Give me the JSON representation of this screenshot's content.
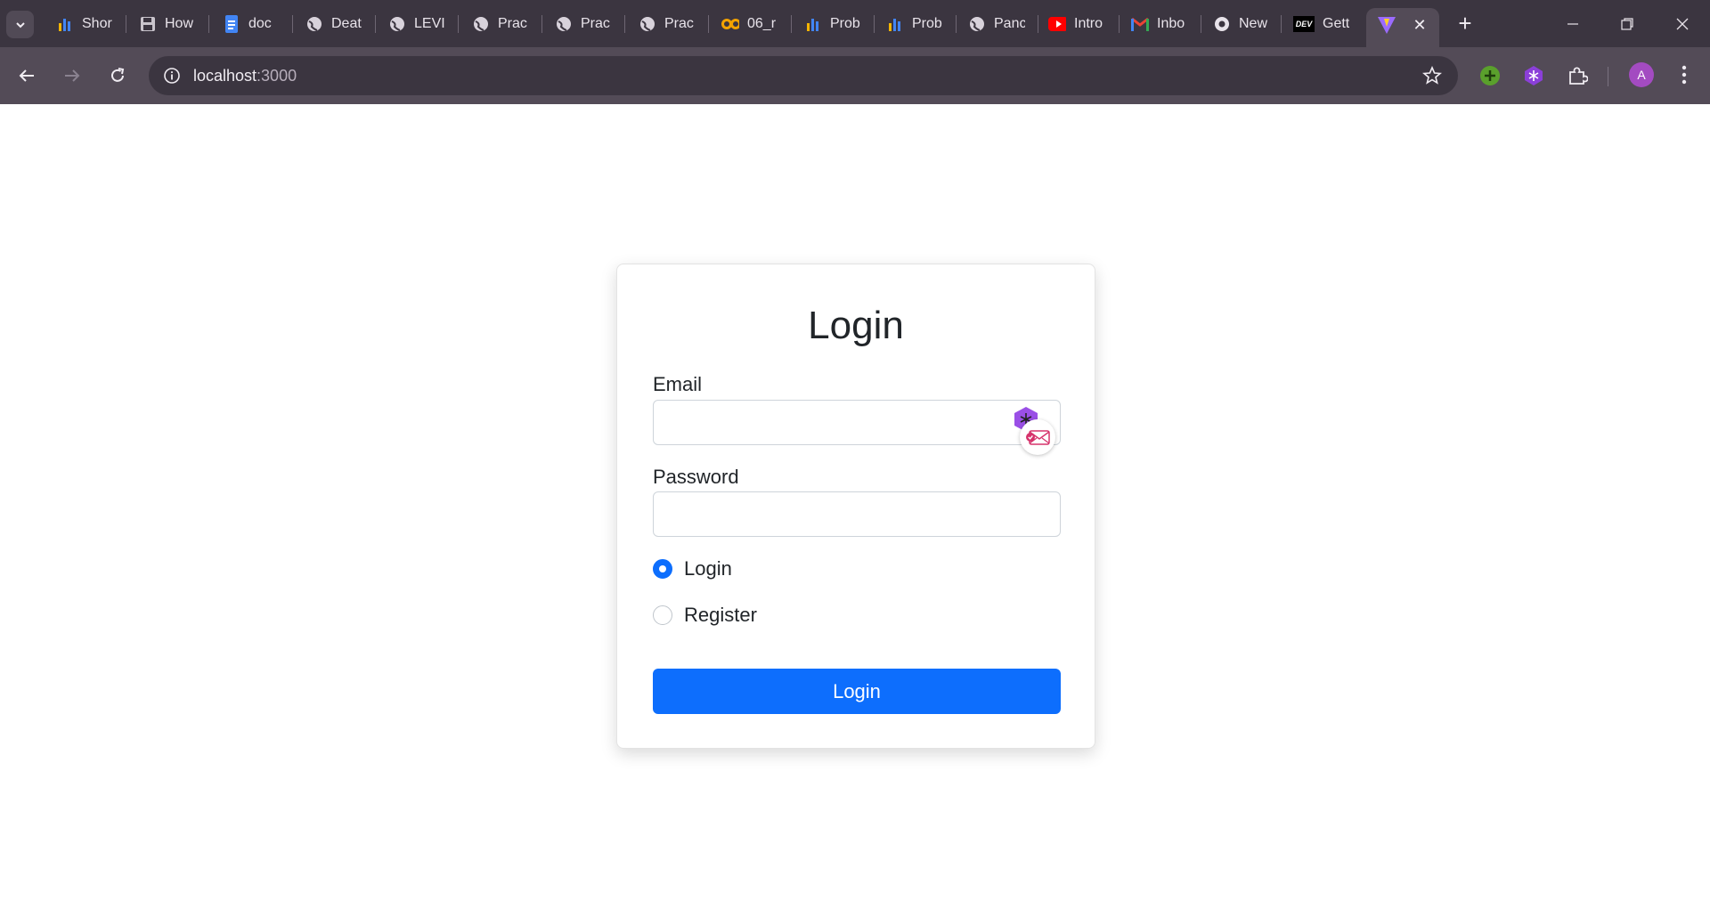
{
  "browser": {
    "tabs": [
      {
        "label": "Shor",
        "icon": "bar-chart-icon"
      },
      {
        "label": "How",
        "icon": "floppy-disk-icon"
      },
      {
        "label": "doc",
        "icon": "google-docs-icon"
      },
      {
        "label": "Deat",
        "icon": "globe-icon"
      },
      {
        "label": "LEVI",
        "icon": "globe-icon"
      },
      {
        "label": "Prac",
        "icon": "globe-icon"
      },
      {
        "label": "Prac",
        "icon": "globe-icon"
      },
      {
        "label": "Prac",
        "icon": "globe-icon"
      },
      {
        "label": "06_r",
        "icon": "infinity-icon"
      },
      {
        "label": "Prob",
        "icon": "bar-chart-icon"
      },
      {
        "label": "Prob",
        "icon": "bar-chart-icon"
      },
      {
        "label": "Panc",
        "icon": "globe-icon"
      },
      {
        "label": "Intro",
        "icon": "youtube-icon"
      },
      {
        "label": "Inbo",
        "icon": "gmail-icon"
      },
      {
        "label": "New",
        "icon": "chrome-icon"
      },
      {
        "label": "Gett",
        "icon": "dev-icon",
        "badge": "DEV"
      }
    ],
    "active_tab": {
      "icon": "vite-icon",
      "close": "✕"
    },
    "new_tab": "+",
    "url_host": "localhost",
    "url_port": ":3000",
    "avatar_letter": "A"
  },
  "form": {
    "title": "Login",
    "email_label": "Email",
    "email_value": "",
    "password_label": "Password",
    "password_value": "",
    "modes": [
      {
        "label": "Login",
        "checked": true
      },
      {
        "label": "Register",
        "checked": false
      }
    ],
    "submit_label": "Login"
  },
  "colors": {
    "primary": "#0d6efd",
    "chrome_dark": "#3b3540",
    "chrome_toolbar": "#534b57"
  }
}
